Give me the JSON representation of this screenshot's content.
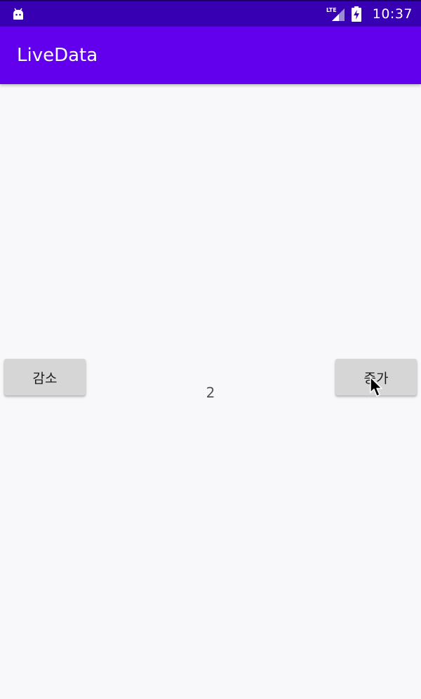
{
  "status_bar": {
    "time": "10:37",
    "network_label": "LTE",
    "left_icon": "android-icon",
    "signal_icon": "cell-signal-icon",
    "battery_icon": "battery-charging-icon",
    "bg_color": "#3700b3"
  },
  "app_bar": {
    "title": "LiveData",
    "bg_color": "#6200ee"
  },
  "buttons": {
    "decrease_label": "감소",
    "increase_label": "증가"
  },
  "counter": {
    "value": "2"
  },
  "cursor_icon": "mouse-pointer-icon"
}
